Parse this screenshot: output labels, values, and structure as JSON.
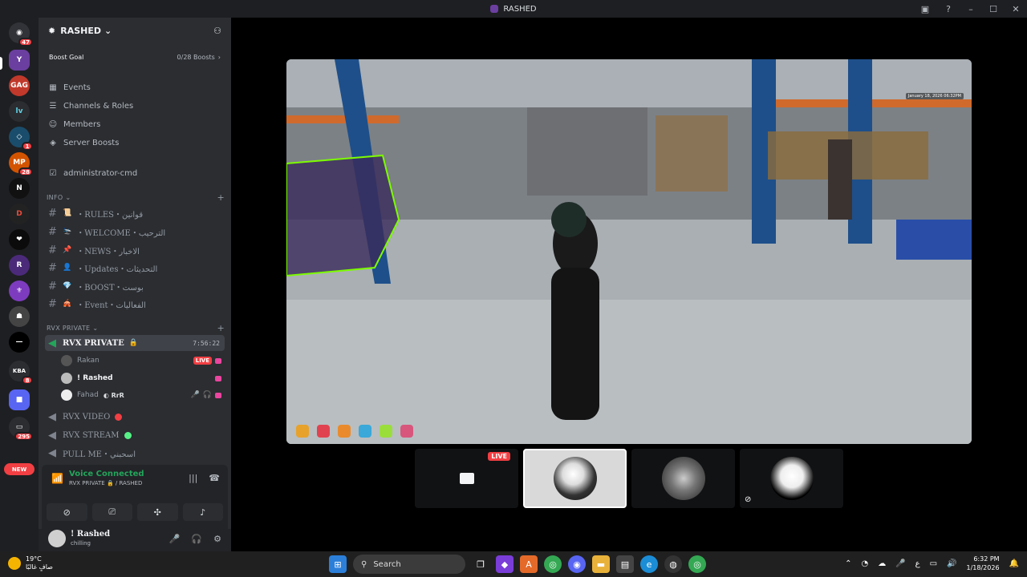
{
  "window": {
    "title": "RASHED"
  },
  "rail": {
    "dm_badge": "47",
    "badges": [
      "1",
      "28",
      "8",
      "295"
    ],
    "new_label": "NEW"
  },
  "server": {
    "name": "RASHED",
    "boost_goal_label": "Boost Goal",
    "boost_goal_count": "0/28 Boosts",
    "menu": [
      "Events",
      "Channels & Roles",
      "Members",
      "Server Boosts",
      "administrator-cmd"
    ]
  },
  "categories": {
    "info": "INFO",
    "private": "RVX PRIVATE"
  },
  "text_channels": [
    {
      "name": "・RULES・قوانين"
    },
    {
      "name": "・WELCOME・الترحيب"
    },
    {
      "name": "・NEWS・الاخبار"
    },
    {
      "name": "・Updates・التحديثات"
    },
    {
      "name": "・BOOST・بوست"
    },
    {
      "name": "・Event・الفعاليات"
    }
  ],
  "voice": {
    "active_channel": "RVX PRIVATE",
    "timer": "7:56:22",
    "users": [
      {
        "name": "Rakan",
        "live": "LIVE"
      },
      {
        "name": "! Rashed"
      },
      {
        "name": "Fahad",
        "tag": "RrR"
      }
    ],
    "other_channels": [
      "RVX VIDEO",
      "RVX STREAM",
      "PULL ME・اسحبني"
    ]
  },
  "voice_panel": {
    "status": "Voice Connected",
    "channel": "RVX PRIVATE 🔒 / RASHED"
  },
  "user": {
    "name": "! Rashed",
    "status": "chilling"
  },
  "stream": {
    "timestamp": "January 18, 2026 06:32PM",
    "live_label": "LIVE"
  },
  "taskbar": {
    "temp": "19°C",
    "weather_desc": "صافٍ غالبًا",
    "search": "Search",
    "time": "6:32 PM",
    "date": "1/18/2026"
  },
  "colors": {
    "accent_green": "#23a55a",
    "live_red": "#f23f43",
    "sidebar": "#2b2d31",
    "rail": "#1e1f22"
  }
}
